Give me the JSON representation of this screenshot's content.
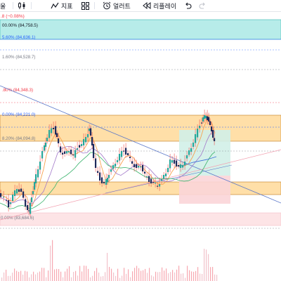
{
  "toolbar": {
    "first_label": "울",
    "indicators_label": "지표",
    "alert_label": "얼러트",
    "replay_label": "리플레이"
  },
  "chart_header": {
    "change_text": ".8 (−0.08%)"
  },
  "fib_levels": [
    {
      "label": "00.00% (84,758.5)",
      "color": "#131722"
    },
    {
      "label": "5.60% (84,636.1)",
      "color": "#2962ff"
    },
    {
      "label": "1.60% (84,528.7)",
      "color": "#787b86"
    },
    {
      "label": ".80% (84,348.3)",
      "color": "#f23645"
    },
    {
      "label": "0.00% (84,221.0)",
      "color": "#2962ff"
    },
    {
      "label": "8.20% (84,094.8)",
      "color": "#787b86"
    },
    {
      "label": "0.00% (83,684.6)",
      "color": "#787b86"
    }
  ],
  "colors": {
    "up": "#26a69a",
    "down": "#1e2a5c",
    "wick": "#ef5350",
    "orange_band": "#ffdfa8",
    "cyan_band": "#b7ece9",
    "pink_band": "#fde4e6",
    "trend_blue": "#5b78c9",
    "trend_pink": "#f3a0b0",
    "ma_orange": "#f7a350",
    "ma_green": "#3ab36c",
    "ma_purple": "#a278c9",
    "ma_blue": "#3a6fd8"
  }
}
